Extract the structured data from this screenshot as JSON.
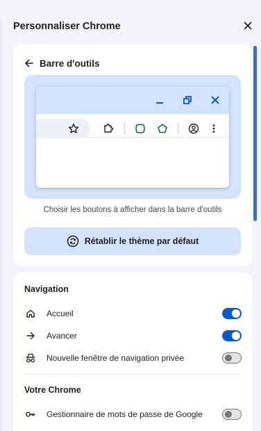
{
  "header": {
    "title": "Personnaliser Chrome",
    "close_icon": "close-icon"
  },
  "toolbar_section": {
    "back_label": "Barre d'outils",
    "caption": "Choisir les boutons à afficher dans la barre d'outils",
    "reset_label": "Rétablir le thème par défaut"
  },
  "preview": {
    "colors": {
      "frame": "#d3e3fd",
      "accent": "#0b57d0",
      "extension_green": "#146c2e"
    }
  },
  "navigation": {
    "title": "Navigation",
    "items": [
      {
        "label": "Accueil",
        "icon": "home-icon",
        "enabled": true
      },
      {
        "label": "Avancer",
        "icon": "arrow-forward-icon",
        "enabled": true
      },
      {
        "label": "Nouvelle fenêtre de navigation privée",
        "icon": "incognito-icon",
        "enabled": false
      }
    ]
  },
  "your_chrome": {
    "title": "Votre Chrome",
    "items": [
      {
        "label": "Gestionnaire de mots de passe de Google",
        "icon": "key-icon",
        "enabled": false
      }
    ]
  },
  "colors": {
    "background": "#f3f4fb",
    "toggle_on": "#0b57d0",
    "toggle_off": "#747775",
    "scrollbar": "#2f6fe0"
  }
}
